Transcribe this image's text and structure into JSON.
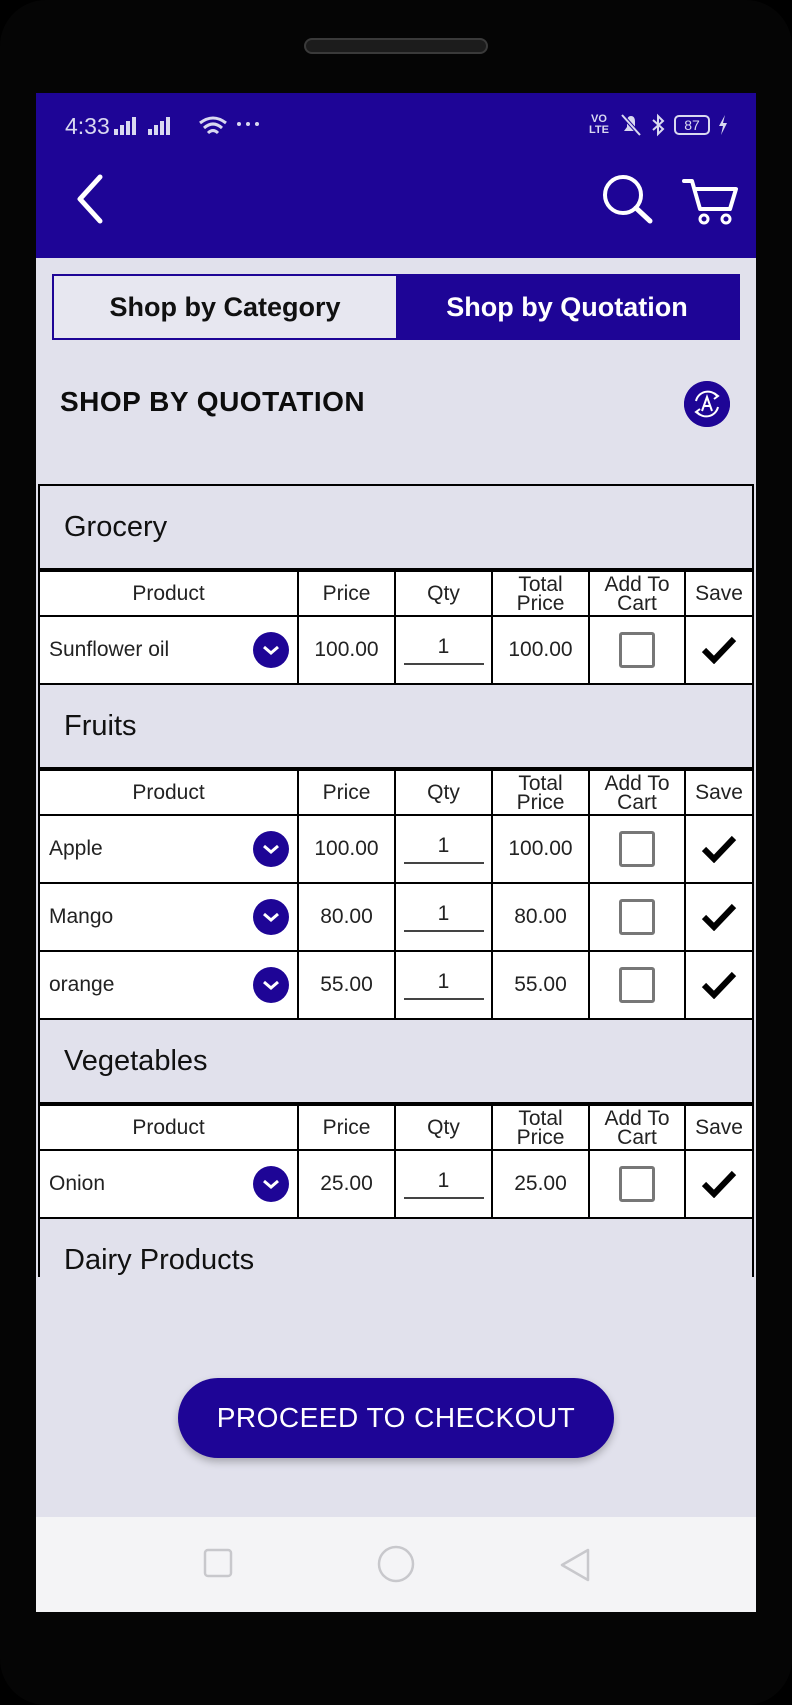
{
  "status": {
    "time": "4:33",
    "battery": "87",
    "volte": "VO LTE"
  },
  "tabs": [
    {
      "label": "Shop by Category",
      "active": false
    },
    {
      "label": "Shop by Quotation",
      "active": true
    }
  ],
  "section_title": "SHOP BY QUOTATION",
  "columns": {
    "product": "Product",
    "price": "Price",
    "qty": "Qty",
    "total": "Total Price",
    "add": "Add To Cart",
    "save": "Save"
  },
  "groups": [
    {
      "name": "Grocery",
      "rows": [
        {
          "product": "Sunflower oil",
          "price": "100.00",
          "qty": "1",
          "total": "100.00"
        }
      ]
    },
    {
      "name": "Fruits",
      "rows": [
        {
          "product": "Apple",
          "price": "100.00",
          "qty": "1",
          "total": "100.00"
        },
        {
          "product": "Mango",
          "price": "80.00",
          "qty": "1",
          "total": "80.00"
        },
        {
          "product": "orange",
          "price": "55.00",
          "qty": "1",
          "total": "55.00"
        }
      ]
    },
    {
      "name": "Vegetables",
      "rows": [
        {
          "product": "Onion",
          "price": "25.00",
          "qty": "1",
          "total": "25.00"
        }
      ]
    },
    {
      "name": "Dairy Products",
      "rows": []
    }
  ],
  "checkout_label": "PROCEED TO CHECKOUT",
  "colors": {
    "primary": "#1e0596",
    "background": "#e1e1ec"
  }
}
